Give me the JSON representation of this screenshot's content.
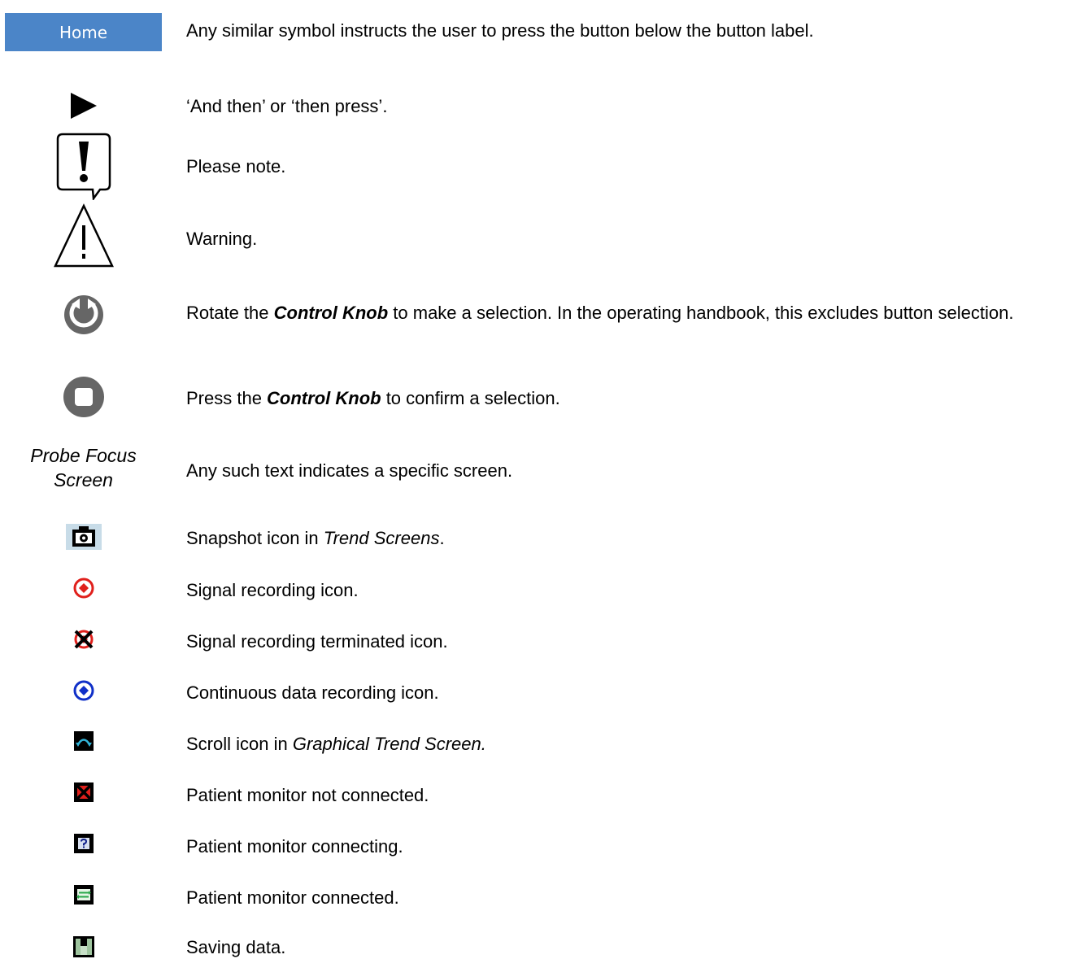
{
  "home_button": {
    "label": "Home"
  },
  "rows": [
    {
      "text": "Any similar symbol instructs the user to press the button below the button label."
    },
    {
      "text": "‘And then’ or ‘then press’."
    },
    {
      "text": "Please note."
    },
    {
      "text": "Warning."
    },
    {
      "pre": "Rotate the ",
      "em": "Control Knob",
      "post": " to make a selection. In the operating handbook, this excludes button selection."
    },
    {
      "pre": "Press the ",
      "em": "Control Knob",
      "post": " to confirm a selection."
    },
    {
      "icon_text": "Probe Focus Screen",
      "text": "Any such text indicates a specific screen."
    },
    {
      "pre": "Snapshot icon in ",
      "em": "Trend Screens",
      "post": "."
    },
    {
      "text": "Signal recording icon."
    },
    {
      "text": "Signal recording terminated icon."
    },
    {
      "text": "Continuous data recording icon."
    },
    {
      "pre": "Scroll icon in ",
      "em": "Graphical Trend Screen.",
      "post": ""
    },
    {
      "text": "Patient monitor not connected."
    },
    {
      "text": "Patient monitor connecting."
    },
    {
      "text": "Patient monitor connected."
    },
    {
      "text": "Saving data."
    }
  ],
  "icons": [
    "home-button",
    "play-arrow-icon",
    "note-speech-bubble-icon",
    "warning-triangle-icon",
    "rotate-knob-icon",
    "press-knob-icon",
    "probe-focus-screen-text",
    "camera-snapshot-icon",
    "signal-recording-icon",
    "signal-recording-terminated-icon",
    "continuous-recording-icon",
    "scroll-icon",
    "monitor-not-connected-icon",
    "monitor-connecting-icon",
    "monitor-connected-icon",
    "save-disk-icon"
  ],
  "colors": {
    "home_button_bg": "#4b85c8",
    "knob_gray": "#666666",
    "record_red": "#e0201c",
    "continuous_blue": "#1030c8",
    "scroll_teal": "#32b4d8",
    "connected_green": "#2aa84a"
  }
}
